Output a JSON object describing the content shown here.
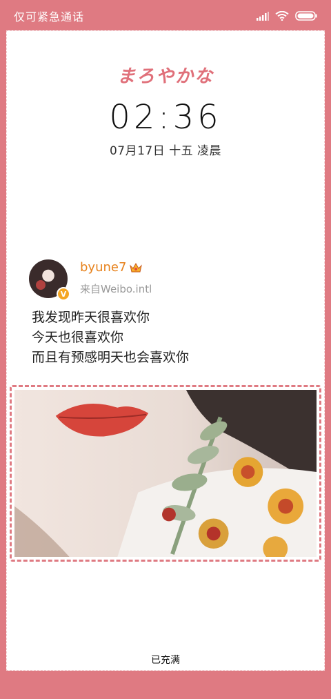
{
  "status_bar": {
    "left_text": "仅可紧急通话",
    "icons": [
      "signal-icon",
      "wifi-icon",
      "battery-icon"
    ]
  },
  "lockscreen": {
    "title": "まろやかな",
    "time": "02:36",
    "date": "07月17日 十五 凌晨",
    "charging": "已充满"
  },
  "post": {
    "username": "byune7",
    "username_badge_icon": "crown-icon",
    "avatar_badge": "V",
    "source": "来自Weibo.intl",
    "text_lines": [
      "我发现昨天很喜欢你",
      "今天也很喜欢你",
      "而且有预感明天也会喜欢你"
    ],
    "image_icon": "photo-lips-roses"
  },
  "colors": {
    "background": "#df7a82",
    "title": "#e0707a",
    "username": "#e7821c",
    "badge": "#f5a623"
  }
}
